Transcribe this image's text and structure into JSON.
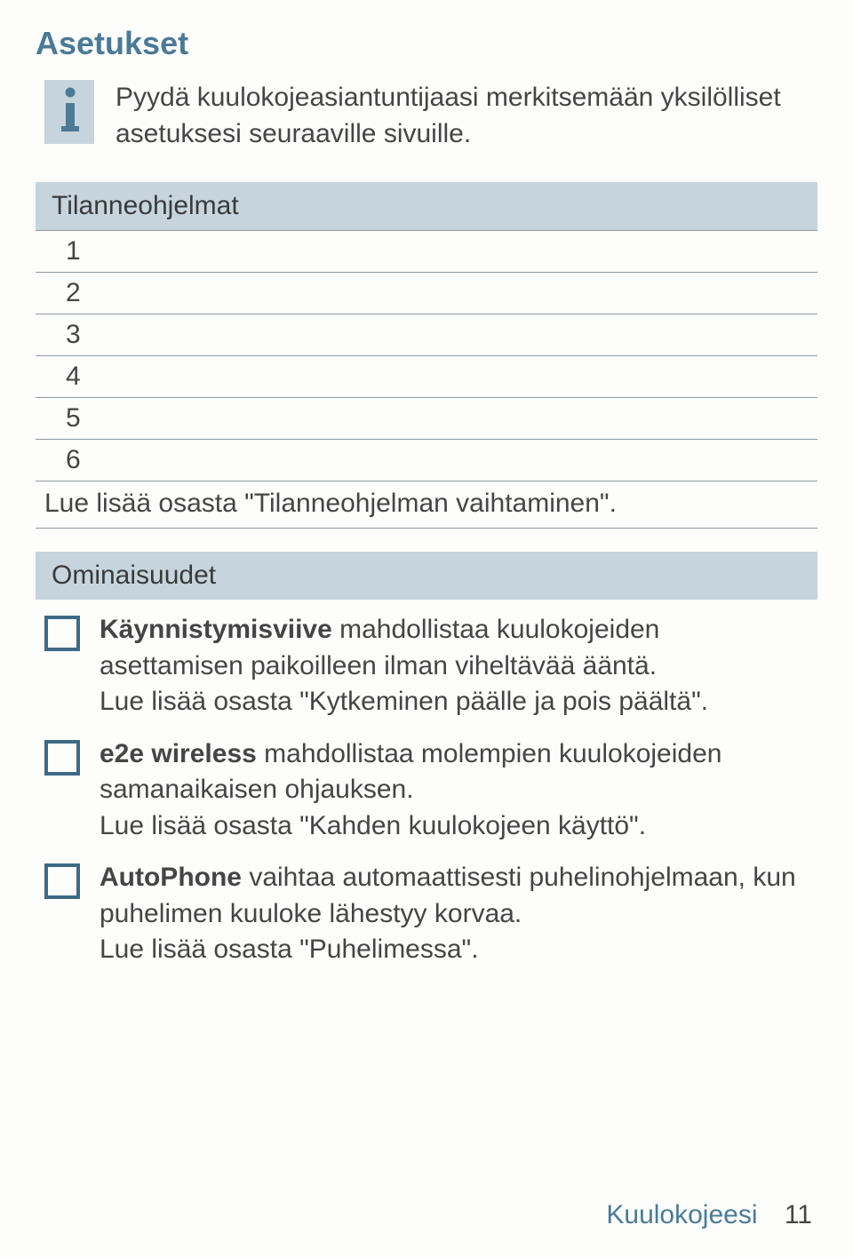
{
  "title": "Asetukset",
  "info": {
    "text": "Pyydä kuulokojeasiantuntijaasi merkitsemään yksilölliset asetuksesi seuraaville sivuille."
  },
  "programs": {
    "header": "Tilanneohjelmat",
    "rows": [
      "1",
      "2",
      "3",
      "4",
      "5",
      "6"
    ],
    "note": "Lue lisää osasta \"Tilanneohjelman vaihtaminen\"."
  },
  "features": {
    "header": "Ominaisuudet",
    "items": [
      {
        "bold": "Käynnistymisviive",
        "rest1": " mahdollistaa kuulokojeiden asettamisen paikoilleen ilman viheltävää ääntä.",
        "line2": "Lue lisää osasta \"Kytkeminen päälle ja pois päältä\"."
      },
      {
        "bold": "e2e wireless",
        "rest1": " mahdollistaa molempien kuulokojeiden samanaikaisen ohjauksen.",
        "line2": "Lue lisää osasta \"Kahden kuulokojeen käyttö\"."
      },
      {
        "bold": "AutoPhone",
        "rest1": " vaihtaa automaattisesti puhelinohjelmaan, kun puhelimen kuuloke lähestyy korvaa.",
        "line2": "Lue lisää osasta \"Puhelimessa\"."
      }
    ]
  },
  "footer": {
    "label": "Kuulokojeesi",
    "page": "11"
  }
}
